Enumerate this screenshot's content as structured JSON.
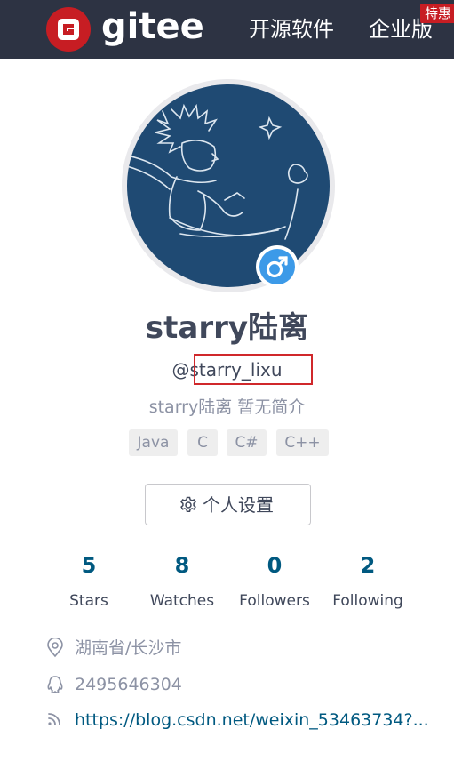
{
  "header": {
    "brand": "gitee",
    "nav": [
      "开源软件",
      "企业版"
    ],
    "badge": "特惠",
    "colors": {
      "bar": "#2d3343",
      "brand": "#c71d23"
    }
  },
  "profile": {
    "display_name": "starry陆离",
    "handle_prefix": "@",
    "handle": "starry_lixu",
    "bio": "starry陆离 暂无简介",
    "gender_icon": "male-icon",
    "tags": [
      "Java",
      "C",
      "C#",
      "C++"
    ],
    "settings_label": "个人设置"
  },
  "stats": [
    {
      "value": "5",
      "label": "Stars"
    },
    {
      "value": "8",
      "label": "Watches"
    },
    {
      "value": "0",
      "label": "Followers"
    },
    {
      "value": "2",
      "label": "Following"
    }
  ],
  "info": {
    "location": "湖南省/长沙市",
    "qq": "2495646304",
    "blog": "https://blog.csdn.net/weixin_53463734?..."
  }
}
